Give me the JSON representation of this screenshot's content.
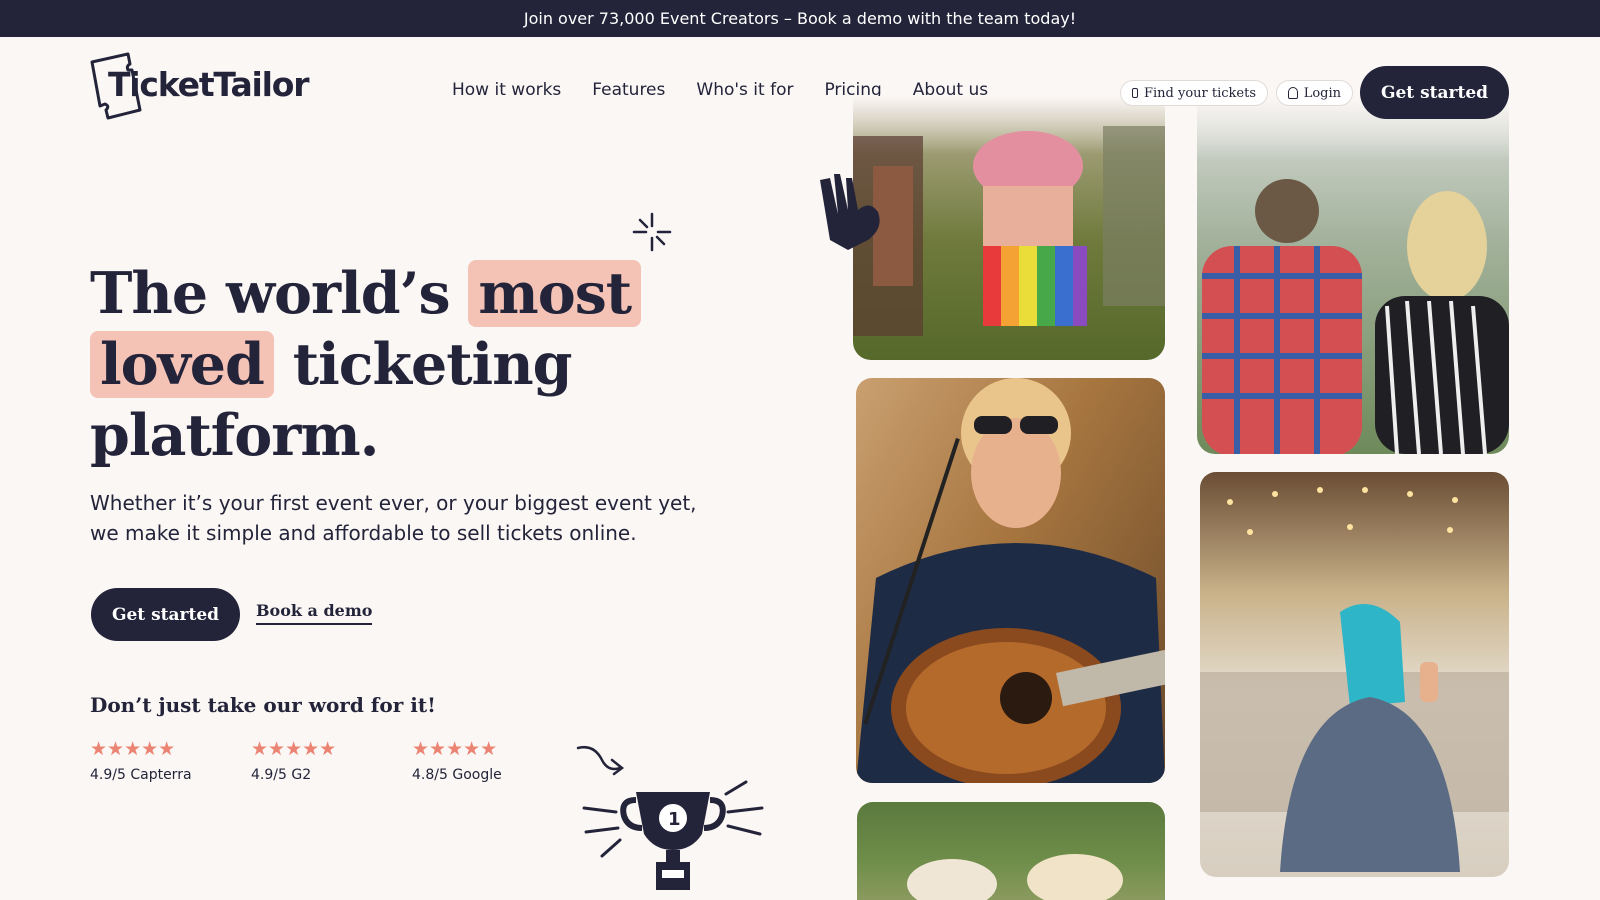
{
  "announcement": "Join over 73,000 Event Creators – Book a demo with the team today!",
  "brand": {
    "name": "TicketTailor",
    "dark": "#23243a",
    "accent": "#f5c2b6",
    "star_color": "#ec8474"
  },
  "nav": {
    "items": [
      "How it works",
      "Features",
      "Who's it for",
      "Pricing",
      "About us"
    ]
  },
  "header_actions": {
    "find_tickets": "Find your tickets",
    "find_tickets_icon": "ticket-icon",
    "login": "Login",
    "login_icon": "user-icon",
    "get_started": "Get started"
  },
  "hero": {
    "title_part1": "The world’s",
    "title_hl1": "most",
    "title_hl2": "loved",
    "title_part2": "ticketing",
    "title_part3": "platform.",
    "subtitle": "Whether it’s your first event ever, or your biggest event yet, we make it simple and affordable to sell tickets online.",
    "cta_primary": "Get started",
    "cta_secondary": "Book a demo"
  },
  "reviews": {
    "heading": "Don’t just take our word for it!",
    "items": [
      {
        "stars": "★★★★★",
        "label": "4.9/5 Capterra"
      },
      {
        "stars": "★★★★★",
        "label": "4.9/5 G2"
      },
      {
        "stars": "★★★★★",
        "label": "4.8/5 Google"
      }
    ]
  },
  "photos": [
    "festival-dancers-photo",
    "festival-crowd-photo",
    "guitarist-singing-photo",
    "conference-speaker-photo",
    "outdoor-hats-photo"
  ]
}
